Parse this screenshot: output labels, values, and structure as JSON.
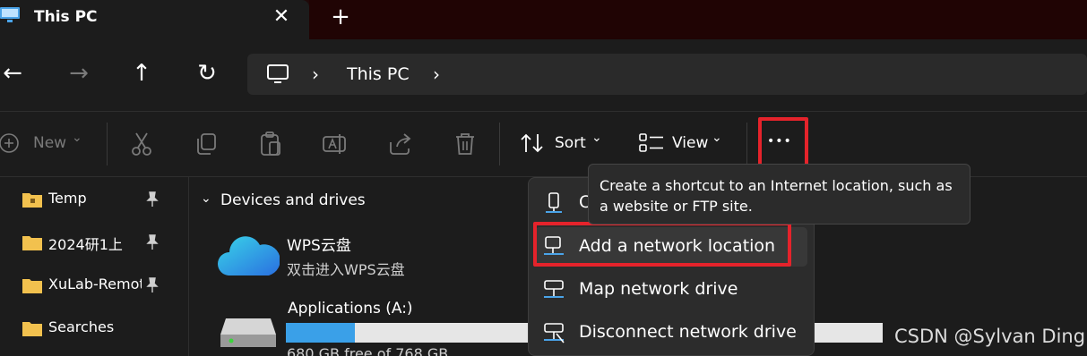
{
  "tab": {
    "title": "This PC",
    "close": "✕",
    "new_tab": "+"
  },
  "nav": {
    "back": "←",
    "forward": "→",
    "up": "↑",
    "refresh": "↻"
  },
  "address": {
    "chev1": "›",
    "location": "This PC",
    "chev2": "›"
  },
  "toolbar": {
    "new_label": "New",
    "new_chev": "⌄",
    "sort_label": "Sort",
    "sort_chev": "⌄",
    "view_label": "View",
    "view_chev": "⌄",
    "more": "•••"
  },
  "sidebar": {
    "items": [
      {
        "label": "Temp",
        "pinned": true
      },
      {
        "label": "2024研1上",
        "pinned": true
      },
      {
        "label": "XuLab-Remote",
        "pinned": true
      },
      {
        "label": "Searches",
        "pinned": false
      }
    ]
  },
  "content": {
    "section_title": "Devices and drives",
    "section_chev": "⌄",
    "drives": [
      {
        "name": "WPS云盘",
        "subtitle": "双击进入WPS云盘"
      },
      {
        "name": "Applications (A:)",
        "subtitle": "680 GB free of 768 GB",
        "used_fraction": 0.115
      }
    ]
  },
  "menu": {
    "items": [
      {
        "label": "Create shortcut",
        "visible_label": "C"
      },
      {
        "label": "Add a network location"
      },
      {
        "label": "Map network drive"
      },
      {
        "label": "Disconnect network drive"
      }
    ]
  },
  "tooltip": {
    "text": "Create a shortcut to an Internet location, such as a website or FTP site."
  },
  "watermark": "CSDN @Sylvan Ding",
  "colors": {
    "accent_highlight": "#e5232b",
    "bar_fill": "#3aa0e8",
    "folder": "#f2c14e"
  }
}
